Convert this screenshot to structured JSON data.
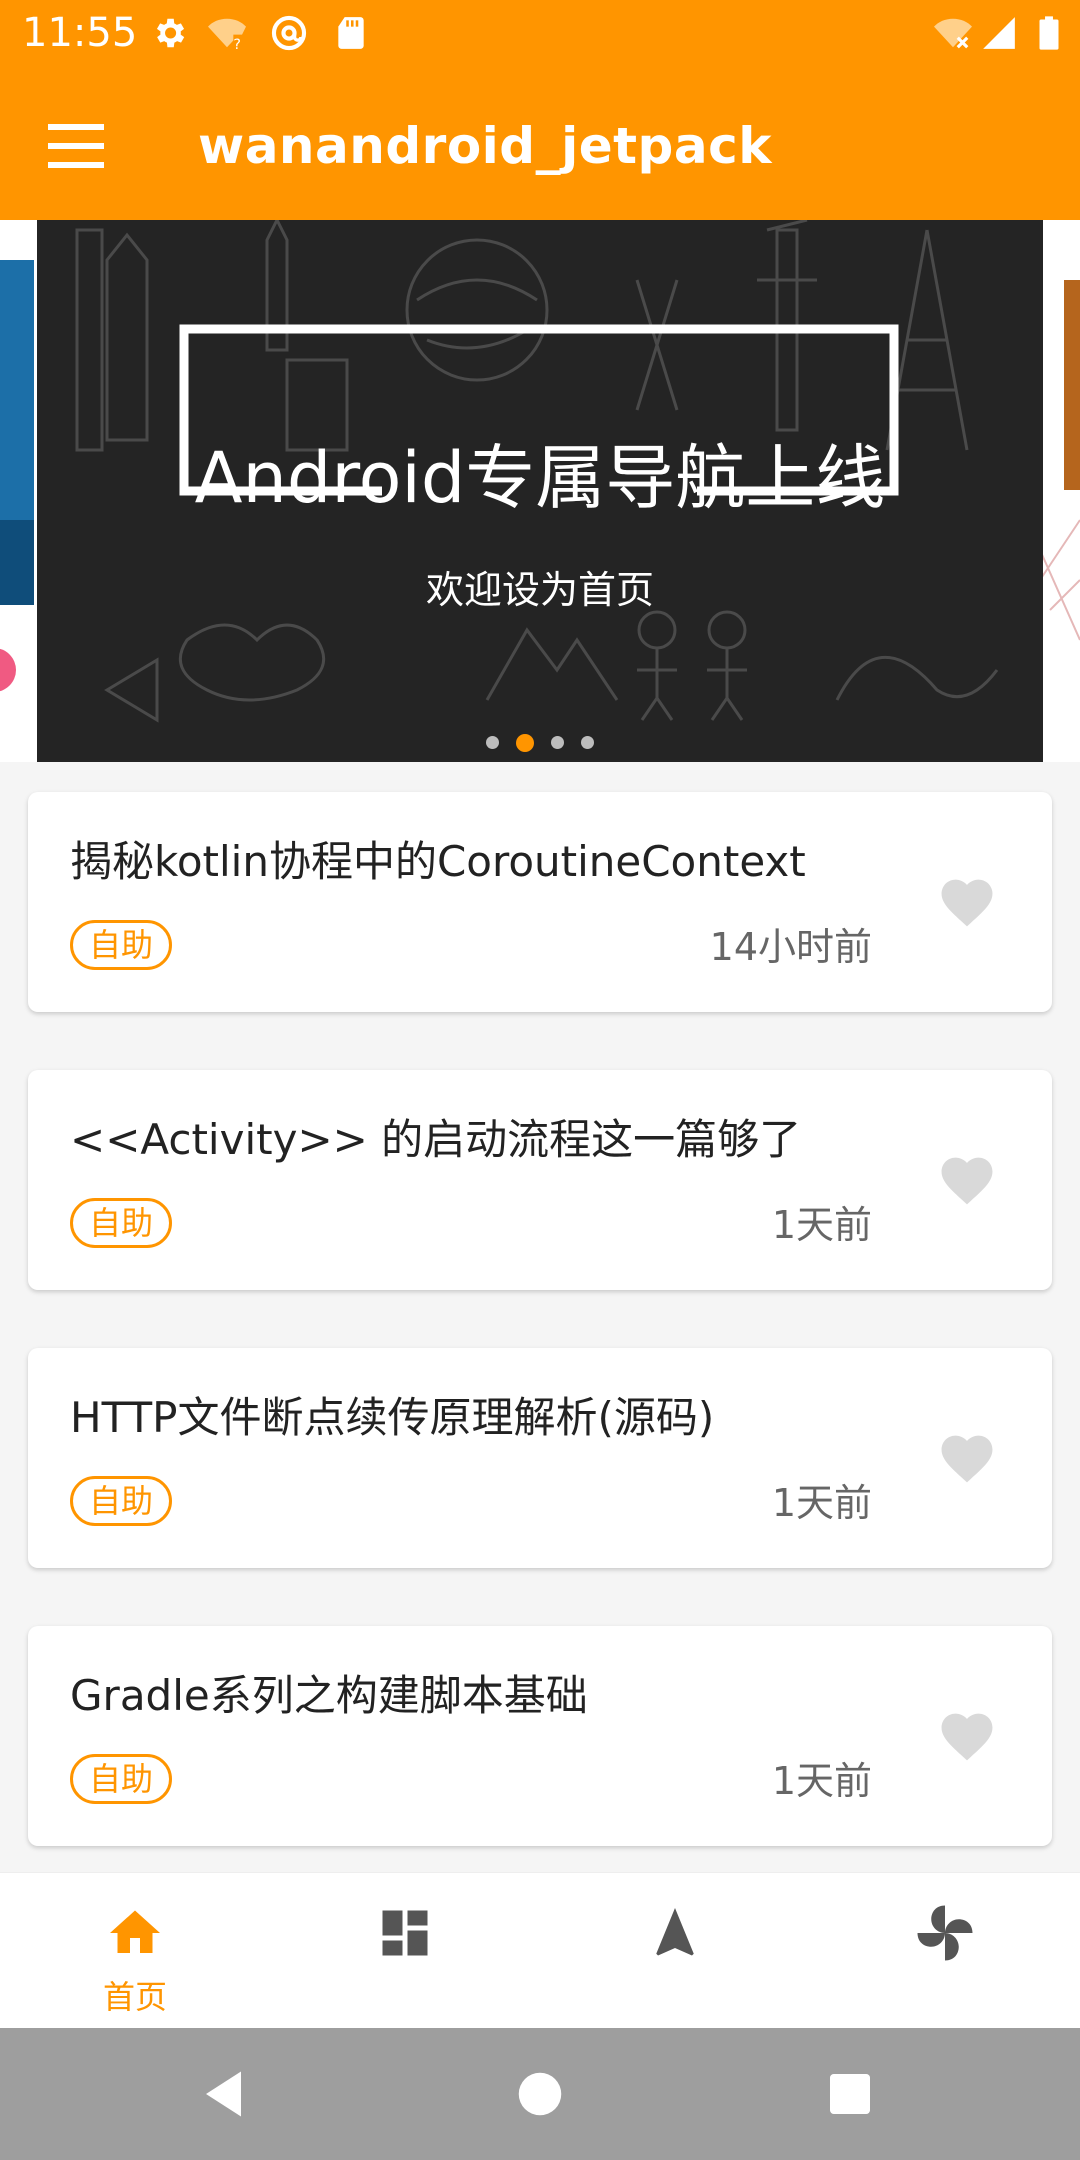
{
  "status_bar": {
    "time": "11:55",
    "icons_left": [
      "settings-icon",
      "wifi-unknown-icon",
      "at-sign-icon",
      "sd-card-icon"
    ],
    "icons_right": [
      "wifi-off-icon",
      "signal-icon",
      "battery-icon"
    ]
  },
  "app_bar": {
    "title": "wanandroid_jetpack",
    "menu_icon": "hamburger-menu-icon",
    "background": "#ff9500"
  },
  "banner": {
    "title": "Android专属导航上线",
    "subtitle": "欢迎设为首页",
    "page_indicator": {
      "count": 4,
      "active": 1
    }
  },
  "articles": [
    {
      "title": "揭秘kotlin协程中的CoroutineContext",
      "tag": "自助",
      "time": "14小时前",
      "favorite_icon": "heart-icon"
    },
    {
      "title": "<<Activity>> 的启动流程这一篇够了",
      "tag": "自助",
      "time": "1天前",
      "favorite_icon": "heart-icon"
    },
    {
      "title": "HTTP文件断点续传原理解析(源码)",
      "tag": "自助",
      "time": "1天前",
      "favorite_icon": "heart-icon"
    },
    {
      "title": "Gradle系列之构建脚本基础",
      "tag": "自助",
      "time": "1天前",
      "favorite_icon": "heart-icon"
    }
  ],
  "bottom_nav": {
    "items": [
      {
        "label": "首页",
        "icon": "home-icon",
        "selected": true
      },
      {
        "label": "",
        "icon": "dashboard-icon",
        "selected": false
      },
      {
        "label": "",
        "icon": "navigation-arrow-icon",
        "selected": false
      },
      {
        "label": "",
        "icon": "pinwheel-icon",
        "selected": false
      }
    ],
    "accent": "#ff9500",
    "inactive": "#555555"
  },
  "system_nav": {
    "buttons": [
      "back-icon",
      "home-circle-icon",
      "recents-icon"
    ]
  }
}
